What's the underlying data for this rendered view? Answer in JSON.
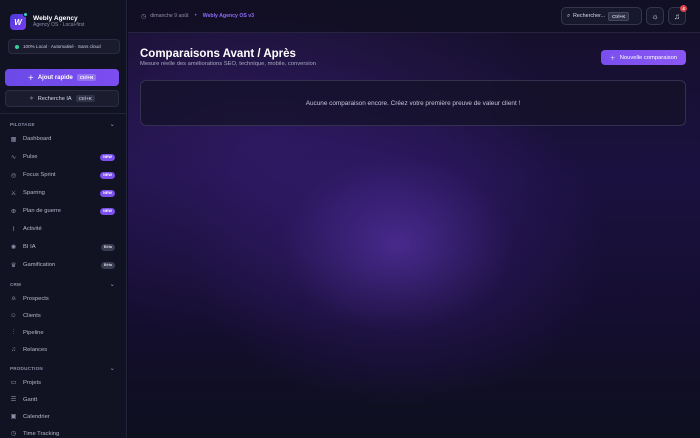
{
  "brand": {
    "name": "Webly Agency",
    "subtitle": "Agency OS · Local-first",
    "logo_letter": "W"
  },
  "local_badge": "100% Local · Automatisé · Sans cloud",
  "quick_add": {
    "label": "Ajout rapide",
    "shortcut": "Ctrl+N"
  },
  "ai_search": {
    "label": "Recherche IA",
    "shortcut": "Ctrl+K"
  },
  "sections": [
    {
      "title": "PILOTAGE",
      "items": [
        {
          "label": "Dashboard",
          "icon": "grid-icon",
          "badge": ""
        },
        {
          "label": "Pulse",
          "icon": "pulse-icon",
          "badge": "NEW"
        },
        {
          "label": "Focus Sprint",
          "icon": "target-icon",
          "badge": "NEW"
        },
        {
          "label": "Sparring",
          "icon": "swords-icon",
          "badge": "NEW"
        },
        {
          "label": "Plan de guerre",
          "icon": "crosshair-icon",
          "badge": "NEW"
        },
        {
          "label": "Activité",
          "icon": "activity-icon",
          "badge": ""
        },
        {
          "label": "BI IA",
          "icon": "brain-icon",
          "badge": "Bêta"
        },
        {
          "label": "Gamification",
          "icon": "trophy-icon",
          "badge": "Bêta"
        }
      ]
    },
    {
      "title": "CRM",
      "items": [
        {
          "label": "Prospects",
          "icon": "user-plus-icon"
        },
        {
          "label": "Clients",
          "icon": "users-icon"
        },
        {
          "label": "Pipeline",
          "icon": "pipeline-icon"
        },
        {
          "label": "Relances",
          "icon": "bell-icon"
        }
      ]
    },
    {
      "title": "PRODUCTION",
      "items": [
        {
          "label": "Projets",
          "icon": "folder-icon"
        },
        {
          "label": "Gantt",
          "icon": "gantt-icon"
        },
        {
          "label": "Calendrier",
          "icon": "calendar-icon"
        },
        {
          "label": "Time Tracking",
          "icon": "clock-icon"
        }
      ]
    }
  ],
  "topbar": {
    "date": "dimanche 9 août",
    "version": "Webly Agency OS v3",
    "search_label": "Rechercher...",
    "search_shortcut": "Ctrl+K",
    "notification_count": "4"
  },
  "page": {
    "title": "Comparaisons Avant / Après",
    "subtitle": "Mesure réelle des améliorations SEO, technique, mobile, conversion",
    "new_button": "Nouvelle comparaison",
    "empty_message": "Aucune comparaison encore. Créez votre première preuve de valeur client !"
  },
  "colors": {
    "accent": "#7c4df0",
    "new_badge": "#7b50ec",
    "online_dot": "#34d399",
    "notification": "#e0424f"
  }
}
